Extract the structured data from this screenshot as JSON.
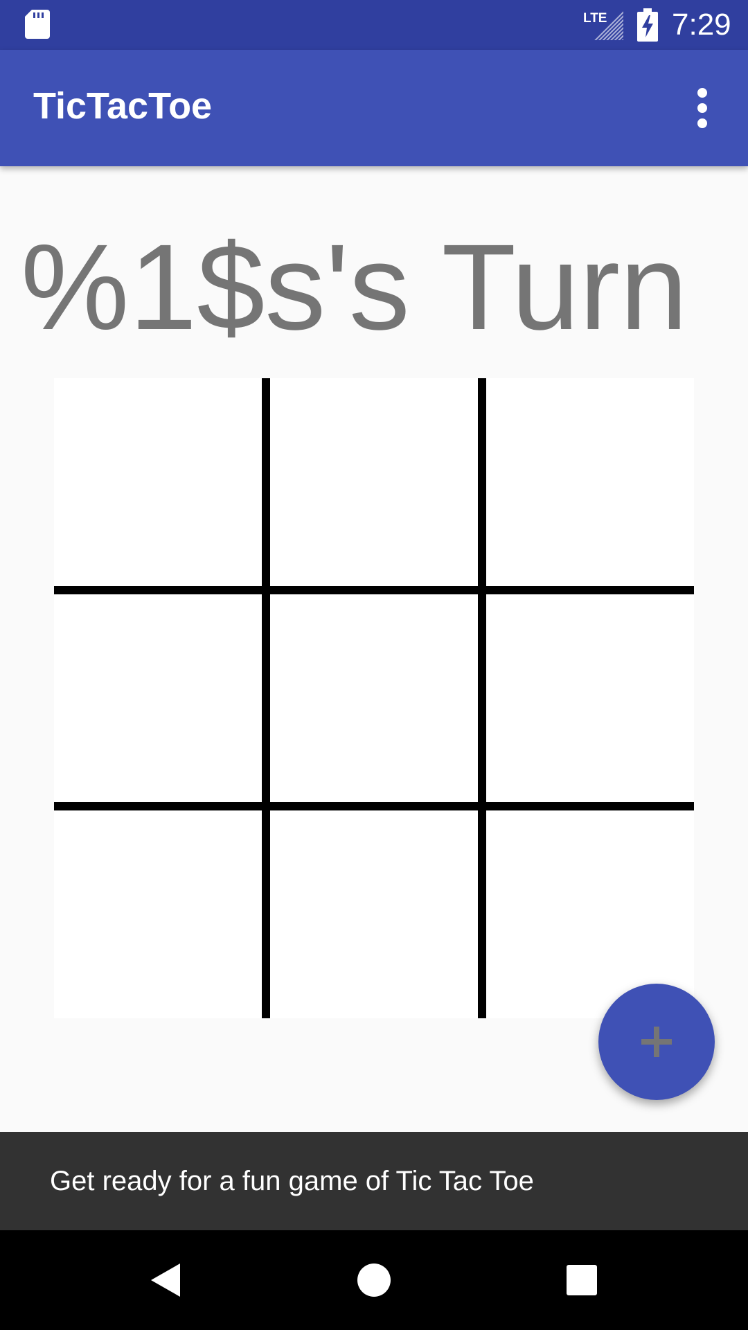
{
  "status_bar": {
    "time": "7:29",
    "network_label": "LTE",
    "icons": [
      "sd-card-icon",
      "lte-signal-icon",
      "battery-charging-icon"
    ]
  },
  "app_bar": {
    "title": "TicTacToe",
    "menu_icon": "more-vert-icon"
  },
  "game": {
    "turn_text": "%1$s's Turn",
    "board_cells": [
      "",
      "",
      "",
      "",
      "",
      "",
      "",
      "",
      ""
    ]
  },
  "fab": {
    "icon": "plus-icon"
  },
  "snackbar": {
    "message": "Get ready for a fun game of Tic Tac Toe"
  },
  "nav_bar": {
    "icons": [
      "back-icon",
      "home-icon",
      "recents-icon"
    ]
  },
  "colors": {
    "status_bar": "#303f9f",
    "primary": "#3f51b5",
    "background": "#fafafa",
    "turn_text": "#757575",
    "snackbar": "#323232",
    "fab_icon": "#757575"
  }
}
